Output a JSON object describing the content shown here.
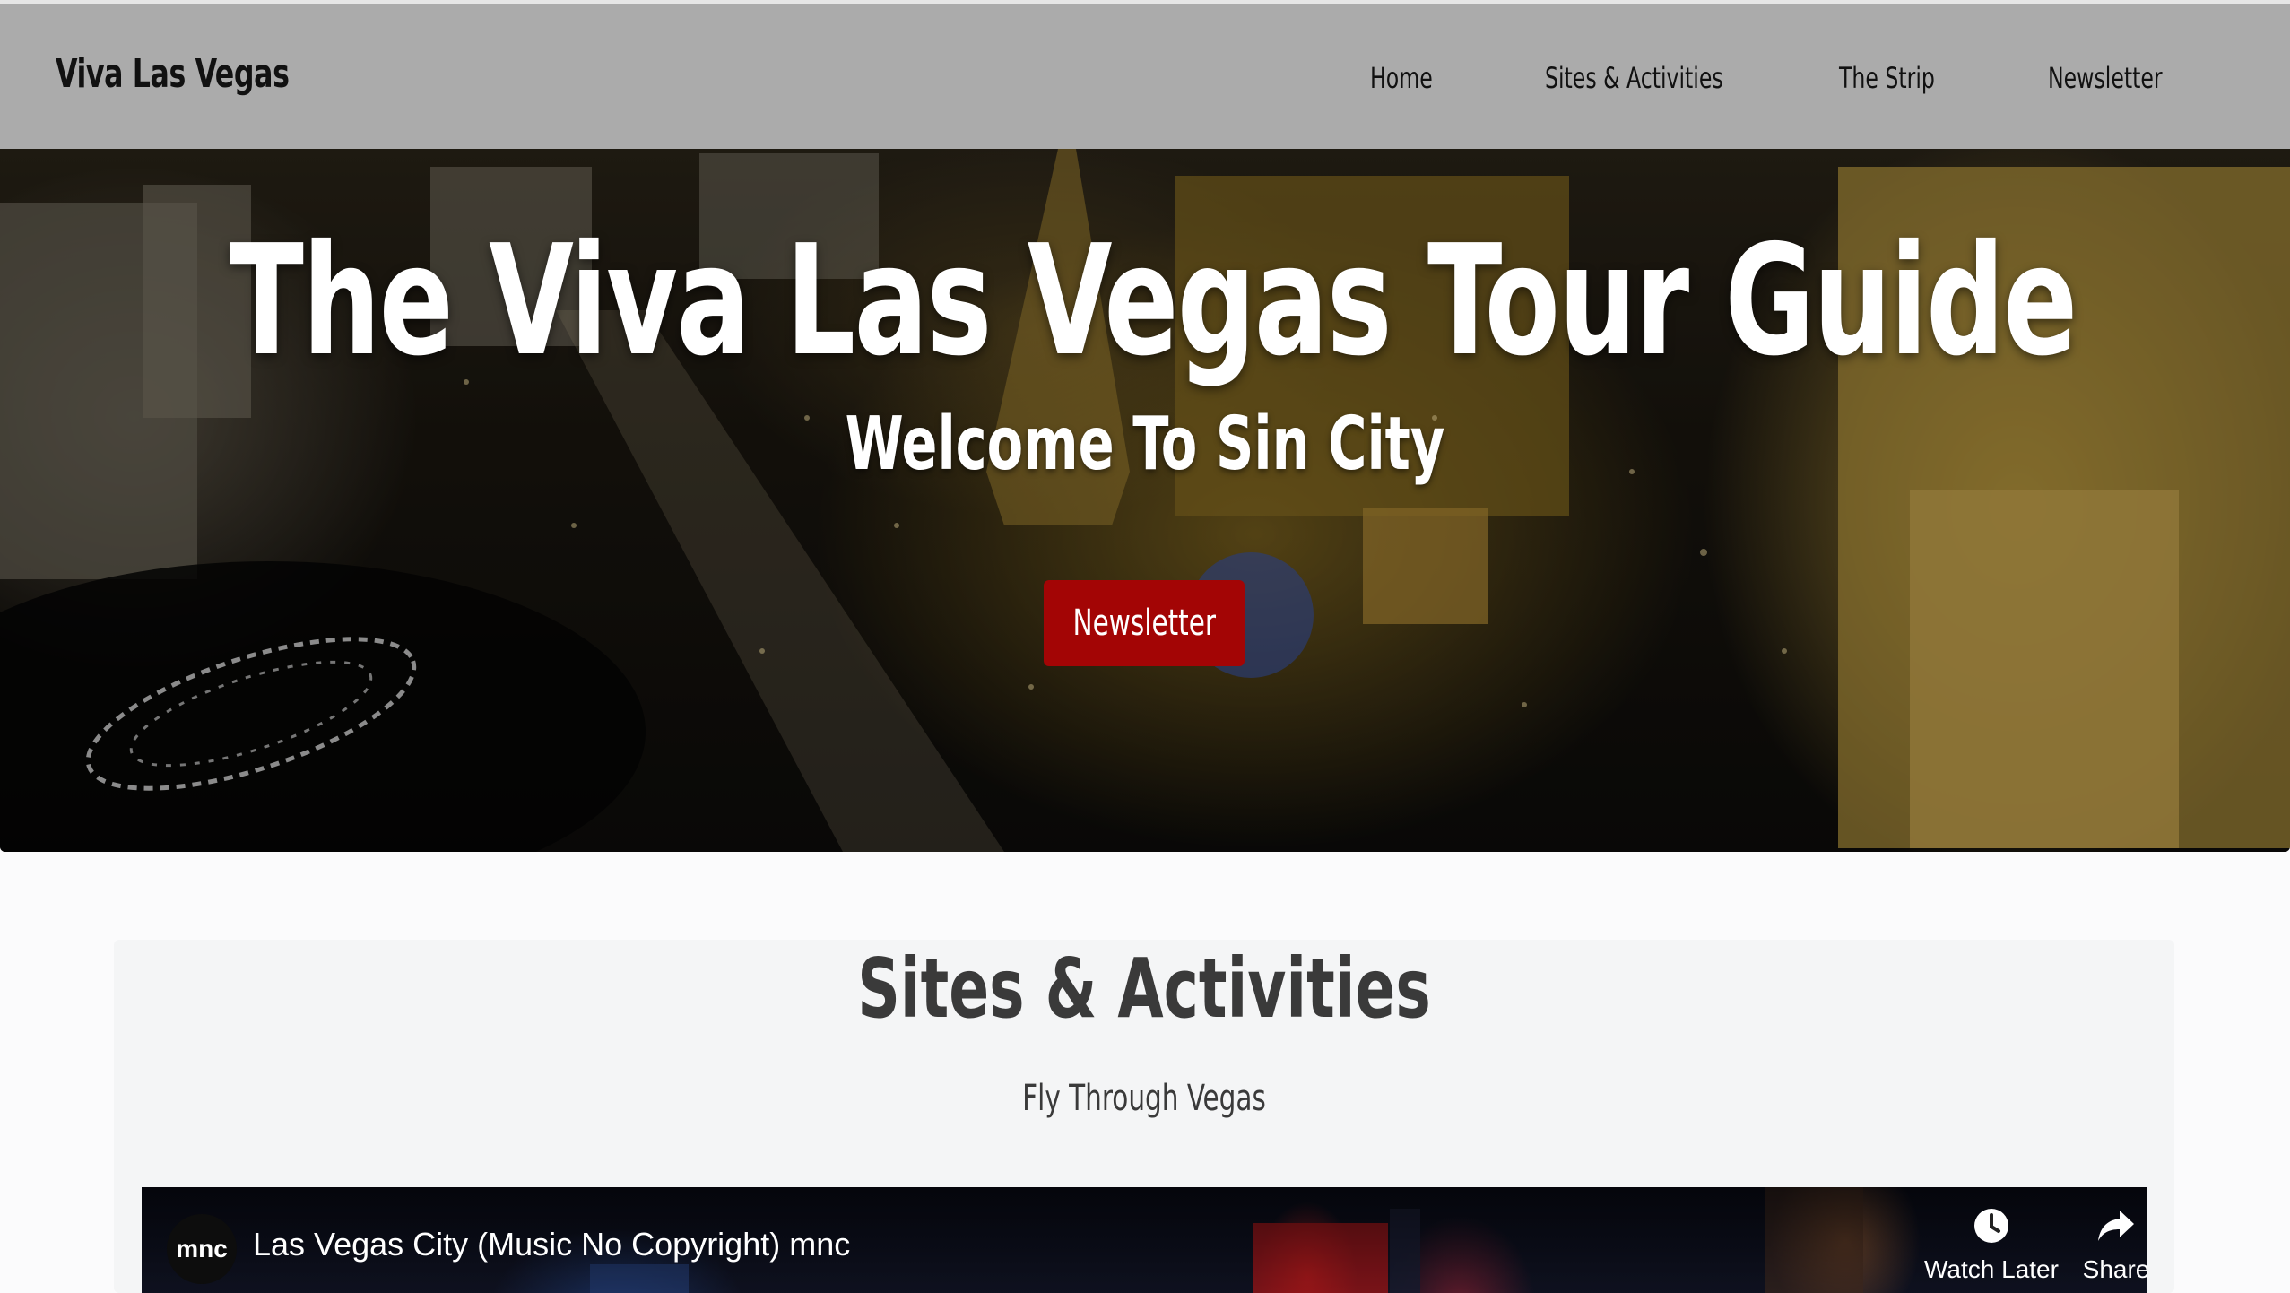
{
  "navbar": {
    "brand": "Viva Las Vegas",
    "links": [
      "Home",
      "Sites & Activities",
      "The Strip",
      "Newsletter"
    ]
  },
  "hero": {
    "title": "The Viva Las Vegas Tour Guide",
    "subtitle": "Welcome To Sin City",
    "button_label": "Newsletter"
  },
  "section": {
    "title": "Sites & Activities",
    "video_caption": "Fly Through Vegas"
  },
  "video": {
    "channel_badge": "mnc",
    "title": "Las Vegas City (Music No Copyright) mnc",
    "watch_later_label": "Watch Later",
    "share_label": "Share"
  },
  "colors": {
    "navbar_bg": "#ababab",
    "button_red": "#a30505",
    "page_bg": "#fbfbfc",
    "section_bg": "#f4f5f6",
    "heading_text": "#3a3a3a"
  },
  "icons": [
    "clock-icon",
    "share-arrow-icon"
  ]
}
